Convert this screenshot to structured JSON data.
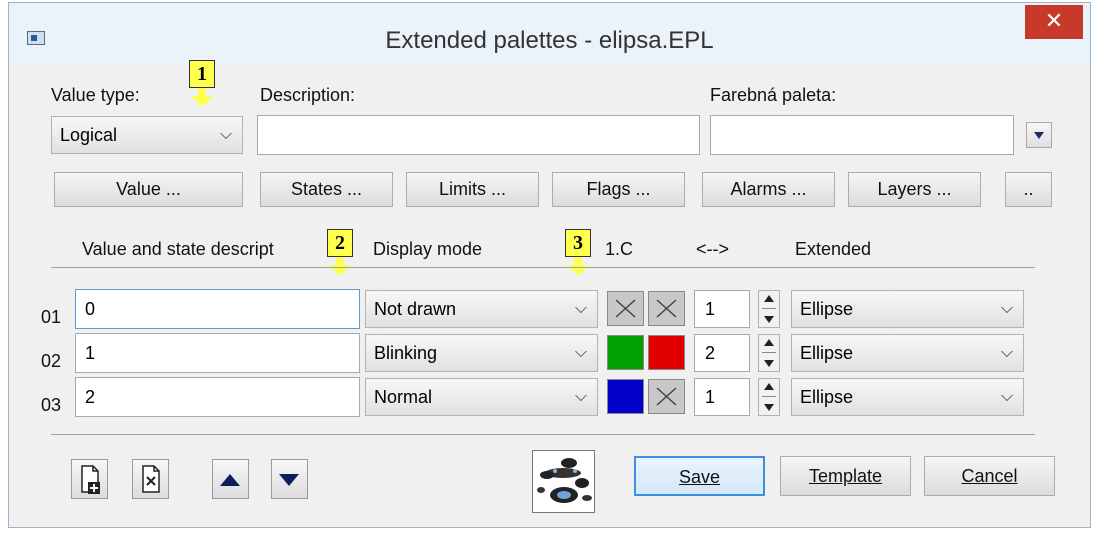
{
  "window": {
    "title": "Extended palettes - elipsa.EPL",
    "close": "✕"
  },
  "top": {
    "value_type_label": "Value type:",
    "value_type_selected": "Logical",
    "description_label": "Description:",
    "description_value": "",
    "palette_label": "Farebná paleta:",
    "palette_value": ""
  },
  "buttons": {
    "value": "Value ...",
    "states": "States ...",
    "limits": "Limits ...",
    "flags": "Flags ...",
    "alarms": "Alarms ...",
    "layers": "Layers ...",
    "more": ".."
  },
  "columns": {
    "desc": "Value and state descript",
    "mode": "Display mode",
    "color": "1.C",
    "swap": "<-->",
    "extended": "Extended"
  },
  "rows": [
    {
      "num": "01",
      "desc": "0",
      "mode": "Not drawn",
      "c1": "none",
      "c2": "none",
      "count": "1",
      "ext": "Ellipse"
    },
    {
      "num": "02",
      "desc": "1",
      "mode": "Blinking",
      "c1": "#00a000",
      "c2": "#e00000",
      "count": "2",
      "ext": "Ellipse"
    },
    {
      "num": "03",
      "desc": "2",
      "mode": "Normal",
      "c1": "#0000c8",
      "c2": "none",
      "count": "1",
      "ext": "Ellipse"
    }
  ],
  "badges": [
    "1",
    "2",
    "3"
  ],
  "footer": {
    "save": "Save",
    "template": "Template",
    "cancel": "Cancel"
  },
  "icons": {
    "new": "new-document-icon",
    "delete": "delete-document-icon",
    "up": "arrow-up-icon",
    "down": "arrow-down-icon",
    "preview": "palette-preview-icon"
  }
}
